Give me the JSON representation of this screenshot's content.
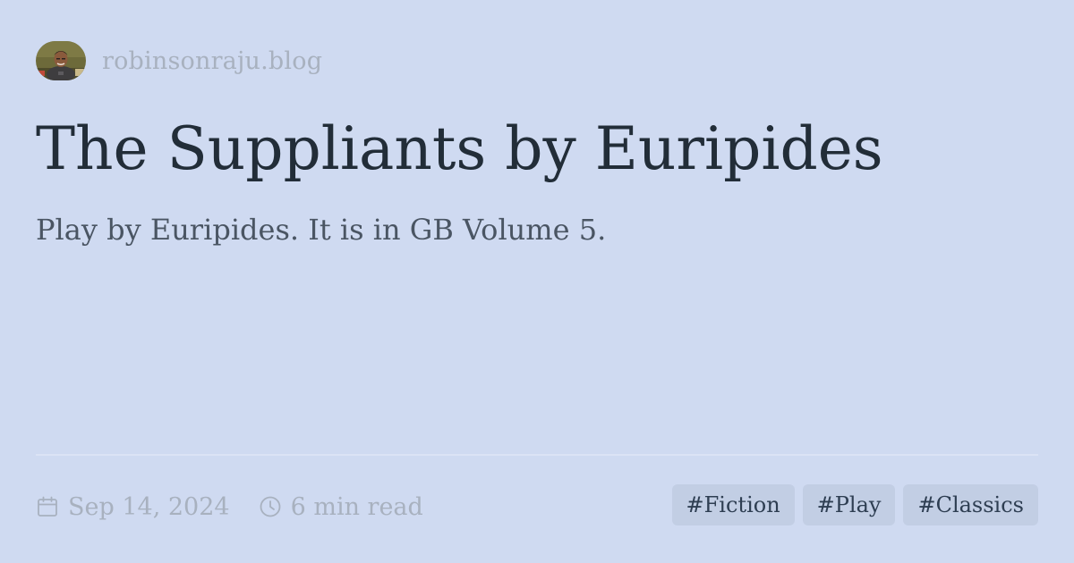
{
  "site": {
    "avatar_icon": "author-avatar-photo",
    "name": "robinsonraju.blog"
  },
  "post": {
    "title": "The Suppliants by Euripides",
    "description": "Play by Euripides. It is in GB Volume 5."
  },
  "meta": {
    "date_icon": "calendar-icon",
    "date": "Sep 14, 2024",
    "reading_time_icon": "clock-icon",
    "reading_time": "6 min read"
  },
  "tags": [
    {
      "label": "#Fiction"
    },
    {
      "label": "#Play"
    },
    {
      "label": "#Classics"
    }
  ],
  "colors": {
    "background": "#cfdaf1",
    "title": "#222d38",
    "muted": "#a8b1bf",
    "tag_bg": "#c2cee4",
    "tag_text": "#2e3e52"
  }
}
